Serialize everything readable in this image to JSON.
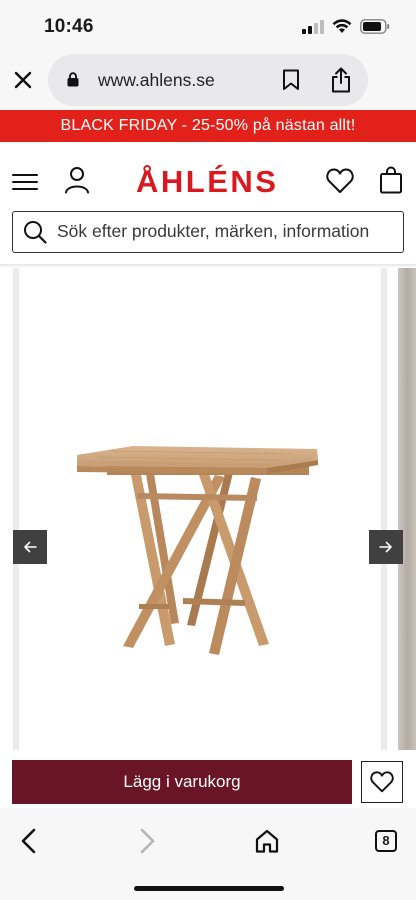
{
  "status": {
    "time": "10:46"
  },
  "browser": {
    "url": "www.ahlens.se",
    "tab_count": "8"
  },
  "banner": {
    "text": "BLACK FRIDAY - 25-50% på nästan allt!"
  },
  "header": {
    "logo": "ÅHLÉNS",
    "search_placeholder": "Sök efter produkter, märken, information"
  },
  "product": {
    "add_to_cart_label": "Lägg i varukorg"
  },
  "colors": {
    "banner_red": "#e3211b",
    "logo_red": "#d9191f",
    "cart_button": "#6a1525"
  },
  "icons": {
    "close": "close-icon",
    "lock": "lock-icon",
    "bookmark": "bookmark-icon",
    "share": "share-icon",
    "menu": "hamburger-menu-icon",
    "user": "user-icon",
    "wishlist": "heart-icon",
    "bag": "shopping-bag-icon",
    "search": "search-icon",
    "prev": "arrow-left-icon",
    "next": "arrow-right-icon",
    "back": "chevron-left-icon",
    "forward": "chevron-right-icon",
    "home": "home-icon"
  }
}
